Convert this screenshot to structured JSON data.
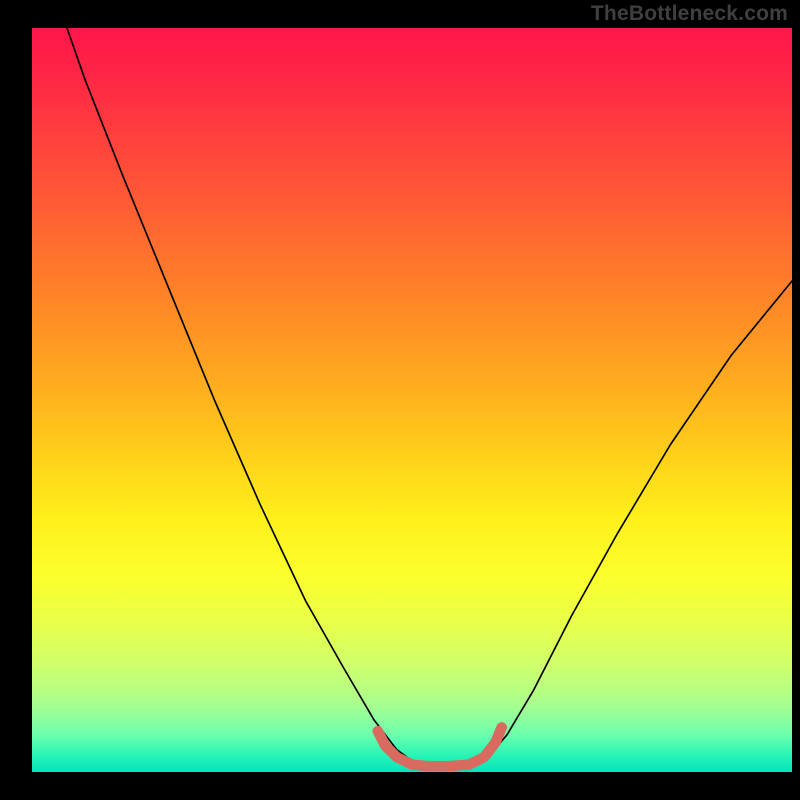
{
  "attribution": {
    "watermark": "TheBottleneck.com"
  },
  "chart_data": {
    "type": "line",
    "title": "",
    "xlabel": "",
    "ylabel": "",
    "series": [
      {
        "name": "bottleneck-curve",
        "points_pct": [
          [
            4.6,
            0.0
          ],
          [
            7.0,
            7.0
          ],
          [
            12.0,
            20.0
          ],
          [
            18.0,
            35.0
          ],
          [
            24.0,
            50.0
          ],
          [
            30.0,
            64.0
          ],
          [
            36.0,
            77.0
          ],
          [
            41.0,
            86.0
          ],
          [
            45.0,
            93.0
          ],
          [
            48.0,
            97.0
          ],
          [
            50.0,
            98.5
          ],
          [
            52.0,
            99.0
          ],
          [
            55.0,
            99.2
          ],
          [
            58.0,
            99.0
          ],
          [
            60.0,
            98.0
          ],
          [
            62.5,
            95.0
          ],
          [
            66.0,
            89.0
          ],
          [
            71.0,
            79.0
          ],
          [
            77.0,
            68.0
          ],
          [
            84.0,
            56.0
          ],
          [
            92.0,
            44.0
          ],
          [
            100.0,
            34.0
          ]
        ]
      },
      {
        "name": "trough-highlight",
        "color": "#d96a60",
        "points_pct": [
          [
            45.5,
            94.5
          ],
          [
            46.5,
            96.5
          ],
          [
            48.0,
            98.0
          ],
          [
            50.0,
            99.0
          ],
          [
            52.0,
            99.2
          ],
          [
            55.0,
            99.2
          ],
          [
            57.5,
            99.0
          ],
          [
            59.5,
            98.0
          ],
          [
            61.0,
            96.0
          ],
          [
            61.8,
            94.0
          ]
        ]
      }
    ],
    "gradient_stops": [
      {
        "pos": 0.0,
        "color": "#ff154b"
      },
      {
        "pos": 0.5,
        "color": "#ffd21a"
      },
      {
        "pos": 0.8,
        "color": "#e8ff4a"
      },
      {
        "pos": 1.0,
        "color": "#08e2bd"
      }
    ]
  }
}
